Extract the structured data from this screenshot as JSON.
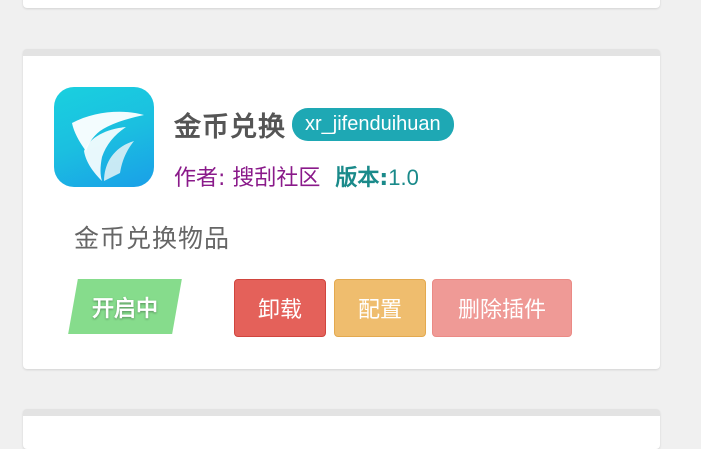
{
  "plugin": {
    "name": "金币兑换",
    "slug": "xr_jifenduihuan",
    "author": "作者: 搜刮社区",
    "version_label": "版本:",
    "version_value": "1.0",
    "description": "金币兑换物品",
    "status": "开启中",
    "icon": "plugin-logo-icon"
  },
  "actions": {
    "uninstall_label": "卸载",
    "config_label": "配置",
    "delete_label": "删除插件"
  },
  "colors": {
    "slug_badge": "#1ea8b4",
    "author_text": "#8a1a8a",
    "version_text": "#1a8a8a",
    "status_green": "#86dc8c",
    "uninstall_red": "#e4615a",
    "config_orange": "#efbd6e",
    "delete_pink": "#ef9a96"
  }
}
